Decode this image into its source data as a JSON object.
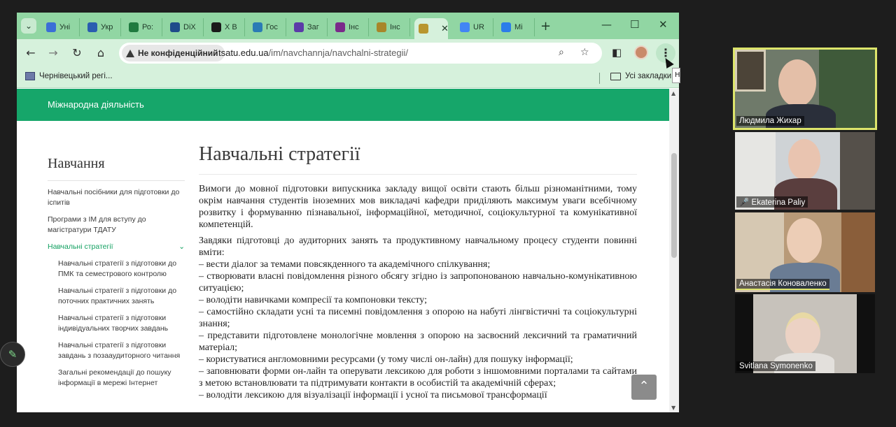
{
  "browser": {
    "tabs": [
      {
        "label": "Уні",
        "color": "#3b6fd6"
      },
      {
        "label": "Укр",
        "color": "#2a5db0"
      },
      {
        "label": "Ро:",
        "color": "#1f7a3f"
      },
      {
        "label": "DiX",
        "color": "#1f4b8a"
      },
      {
        "label": "X В",
        "color": "#1a1a1a"
      },
      {
        "label": "Гос",
        "color": "#2a7bb5"
      },
      {
        "label": "Заг",
        "color": "#5b3aa8"
      },
      {
        "label": "Інс",
        "color": "#7a2a8a"
      },
      {
        "label": "Інс",
        "color": "#a8862a"
      },
      {
        "label": "",
        "color": "#b8962e",
        "active": true
      },
      {
        "label": "UR",
        "color": "#4285f4"
      },
      {
        "label": "Mi",
        "color": "#2b7de9"
      }
    ],
    "new_tab": "+",
    "window_controls": {
      "minimize": "—",
      "maximize": "☐",
      "close": "✕"
    },
    "nav": {
      "back": "←",
      "forward": "→",
      "reload": "↻",
      "home": "⌂"
    },
    "security_label": "Не конфіденційний",
    "url_host": "tsatu.edu.ua",
    "url_path": "/im/navchannja/navchalni-strategii/",
    "bookmarks": {
      "item": "Чернівецький регі...",
      "all_bookmarks": "Усі закладки"
    },
    "tooltip_text": "Н"
  },
  "site": {
    "nav_label": "Міжнародна діяльність",
    "sidebar": {
      "title": "Навчання",
      "items": [
        "Навчальні посібники для підготовки до іспитів",
        "Програми з ІМ для вступу до магістратури ТДАТУ"
      ],
      "active_item": "Навчальні стратегії",
      "active_chevron": "⌄",
      "subitems": [
        "Навчальні стратегії з підготовки до ПМК та семестрового контролю",
        "Навчальні стратегії з підготовки до поточних практичних занять",
        "Навчальні стратегії з підготовки індивідуальних творчих завдань",
        "Навчальні стратегії з підготовки завдань з позааудиторного читання",
        "Загальні рекомендації до пошуку інформації в мережі Інтернет"
      ]
    },
    "content": {
      "title": "Навчальні стратегії",
      "intro": "Вимоги до мовної підготовки випускника закладу вищої освіти стають більш різноманітними, тому окрім навчання студентів іноземних мов викладачі кафедри приділяють максимум уваги всебічному розвитку і формуванню пізнавальної, інформаційної, методичної, соціокультурної та комунікативної компетенцій.",
      "lead": "Завдяки підготовці до аудиторних занять та продуктивному навчальному процесу студенти повинні вміти:",
      "bullets": [
        "– вести діалог за темами повсякденного та академічного спілкування;",
        "– створювати власні повідомлення різного обсягу згідно із запропонованою навчально-комунікативною ситуацією;",
        "– володіти навичками компресії та компоновки тексту;",
        "– самостійно складати усні та писемні повідомлення з опорою на набуті лінгвістичні та соціокультурні знання;",
        "– представити підготовлене монологічне мовлення з опорою на засвоєний лексичний та граматичний матеріал;",
        "– користуватися англомовними ресурсами (у тому числі он-лайн) для пошуку інформації;",
        "– заповнювати форми он-лайн та оперувати лексикою для роботи з іншомовними порталами та сайтами з метою встановлювати та підтримувати контакти в особистій та академічній сферах;",
        "– володіти лексикою для візуалізації інформації і усної та письмової трансформації"
      ]
    },
    "to_top": "⌃"
  },
  "participants": [
    {
      "name": "Людмила Жихар",
      "speaking": true
    },
    {
      "name": "Ekaterina Paliy",
      "muted": true
    },
    {
      "name": "Анастасія Коноваленко"
    },
    {
      "name": "Svitlana Symonenko"
    }
  ],
  "muted_icon": "🎤"
}
